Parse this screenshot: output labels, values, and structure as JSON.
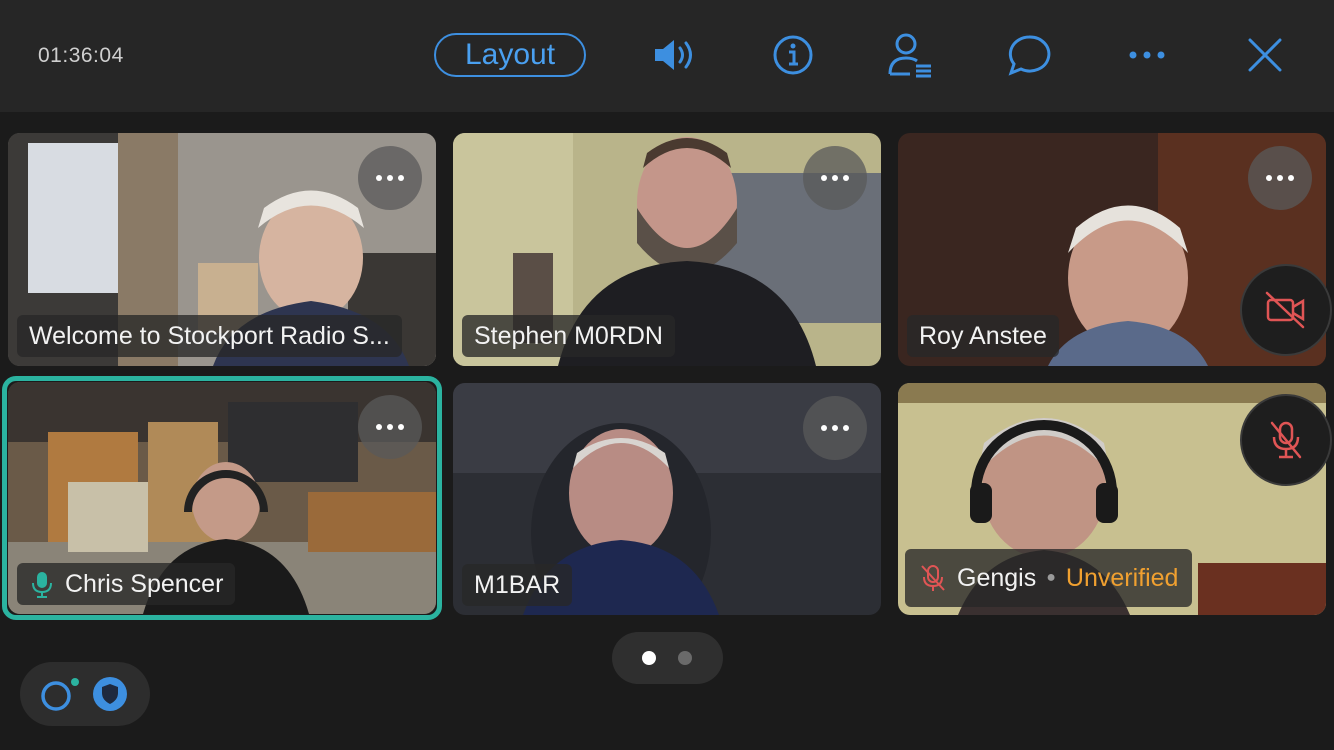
{
  "header": {
    "timer": "01:36:04",
    "layout_label": "Layout",
    "icons": [
      "speaker-icon",
      "info-icon",
      "participants-icon",
      "chat-icon",
      "more-icon",
      "close-icon"
    ],
    "accent_color": "#4aa0f0"
  },
  "participants": [
    {
      "name": "Welcome to Stockport Radio S...",
      "muted": false,
      "video_off": false,
      "active_speaker": false
    },
    {
      "name": "Stephen M0RDN",
      "muted": false,
      "video_off": false,
      "active_speaker": false
    },
    {
      "name": "Roy Anstee",
      "muted": false,
      "video_off": true,
      "active_speaker": false
    },
    {
      "name": "Chris Spencer",
      "muted": false,
      "speaking": true,
      "active_speaker": true
    },
    {
      "name": "M1BAR",
      "muted": false,
      "video_off": false,
      "active_speaker": false
    },
    {
      "name": "Gengis",
      "muted": true,
      "status": "Unverified",
      "active_speaker": false
    }
  ],
  "pager": {
    "pages": 2,
    "current": 1
  },
  "connection": {
    "icons": [
      "connection-icon",
      "shield-icon"
    ]
  },
  "colors": {
    "active_ring": "#2bb3a0",
    "muted_red": "#e05555",
    "unverified": "#f0a030"
  }
}
